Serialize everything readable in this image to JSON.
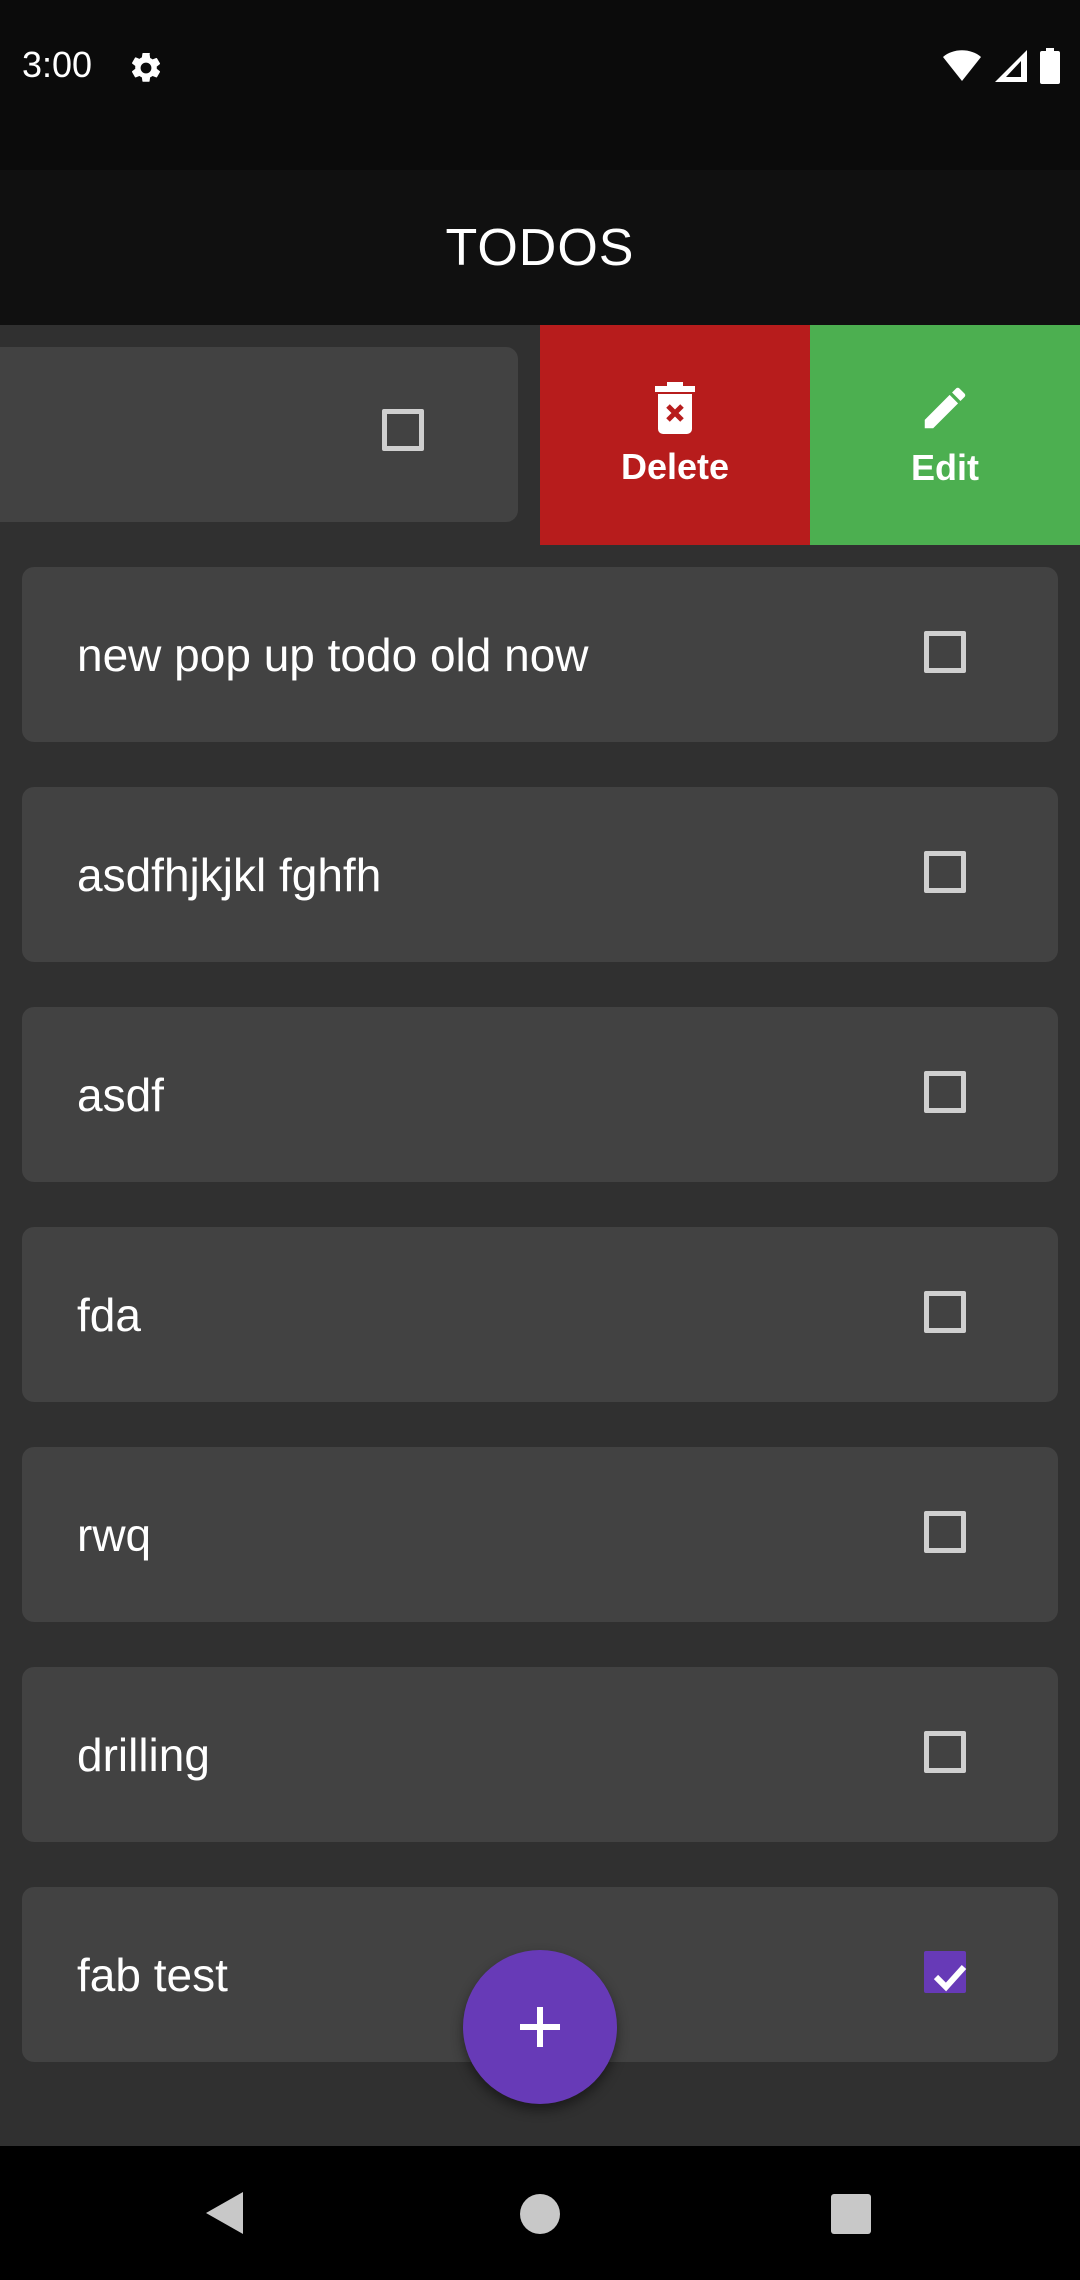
{
  "status_bar": {
    "time": "3:00",
    "icons": [
      "gear-icon",
      "wifi-icon",
      "signal-icon",
      "battery-icon"
    ]
  },
  "app_bar": {
    "title": "TODOS"
  },
  "swipe_actions": {
    "delete_label": "Delete",
    "edit_label": "Edit",
    "delete_color": "#b71c1c",
    "edit_color": "#4caf50"
  },
  "todos": [
    {
      "text": "new pop up todo old now",
      "checked": false
    },
    {
      "text": "asdfhjkjkl fghfh",
      "checked": false
    },
    {
      "text": "asdf",
      "checked": false
    },
    {
      "text": "fda",
      "checked": false
    },
    {
      "text": "rwq",
      "checked": false
    },
    {
      "text": "drilling",
      "checked": false
    },
    {
      "text": "fab test",
      "checked": true
    }
  ],
  "fab": {
    "icon": "plus-icon",
    "color": "#673ab7"
  },
  "nav_bar": {
    "icons": [
      "back-icon",
      "home-icon",
      "recents-icon"
    ]
  }
}
